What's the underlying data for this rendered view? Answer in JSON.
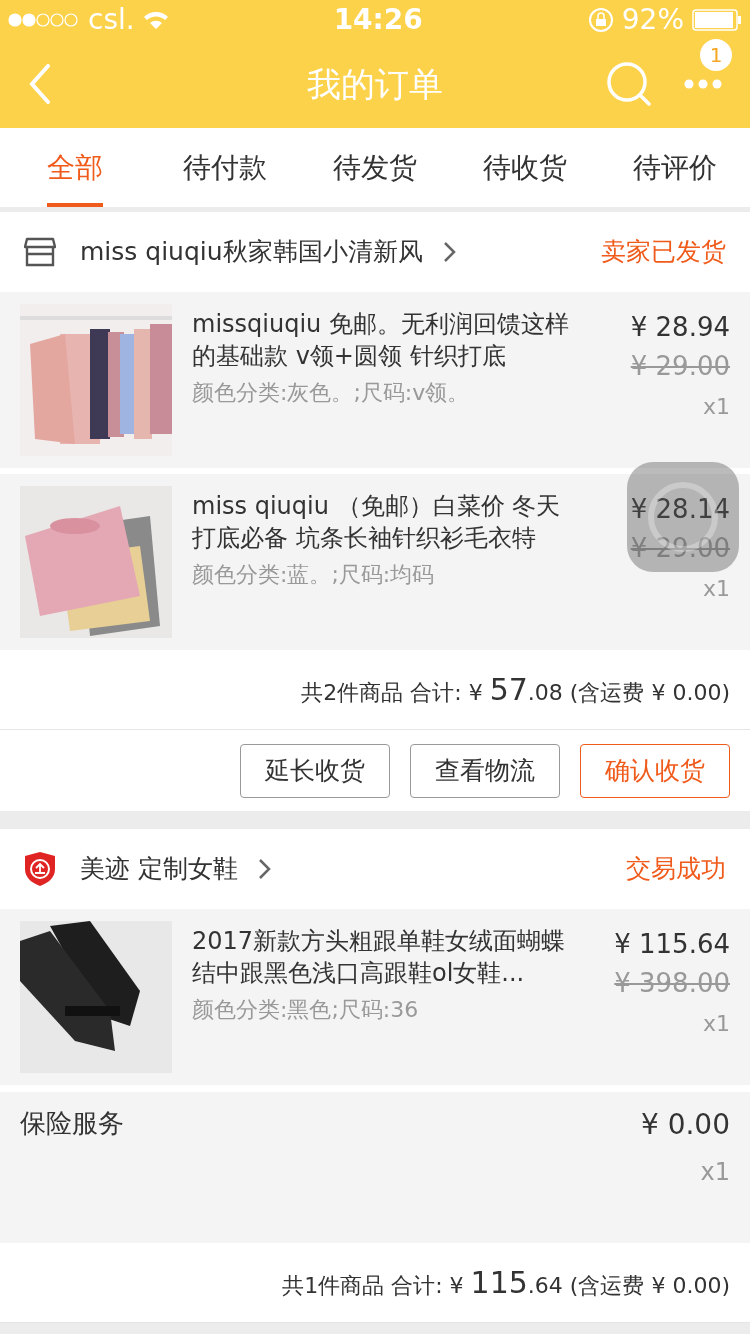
{
  "status_bar": {
    "carrier": "csl.",
    "time": "14:26",
    "battery": "92%"
  },
  "nav": {
    "title": "我的订单",
    "badge": "1"
  },
  "tabs": [
    {
      "label": "全部",
      "selected": true
    },
    {
      "label": "待付款",
      "selected": false
    },
    {
      "label": "待发货",
      "selected": false
    },
    {
      "label": "待收货",
      "selected": false
    },
    {
      "label": "待评价",
      "selected": false
    }
  ],
  "orders": [
    {
      "shop": {
        "kind": "store",
        "name": "miss qiuqiu秋家韩国小清新风"
      },
      "status": "卖家已发货",
      "items": [
        {
          "kind": "product",
          "title": "missqiuqiu 免邮。无利润回馈这样的基础款 v领+圆领 针织打底",
          "spec": "颜色分类:灰色。;尺码:v领。",
          "price": "¥ 28.94",
          "original_price": "¥ 29.00",
          "qty": "x1"
        },
        {
          "kind": "product",
          "title": "miss qiuqiu （免邮）白菜价 冬天打底必备 坑条长袖针织衫毛衣特",
          "spec": "颜色分类:蓝。;尺码:均码",
          "price": "¥ 28.14",
          "original_price": "¥ 29.00",
          "qty": "x1"
        }
      ],
      "total": {
        "label": "共2件商品 合计:",
        "currency": "¥",
        "integer": "57",
        "decimal": ".08",
        "shipping": "(含运费 ¥ 0.00)"
      },
      "buttons": [
        {
          "label": "延长收货",
          "highlighted": false
        },
        {
          "label": "查看物流",
          "highlighted": false
        },
        {
          "label": "确认收货",
          "highlighted": true
        }
      ]
    },
    {
      "shop": {
        "kind": "enterprise",
        "name": "美迹 定制女鞋"
      },
      "status": "交易成功",
      "items": [
        {
          "kind": "product",
          "title": "2017新款方头粗跟单鞋女绒面蝴蝶结中跟黑色浅口高跟鞋ol女鞋...",
          "spec": "颜色分类:黑色;尺码:36",
          "price": "¥ 115.64",
          "original_price": "¥ 398.00",
          "qty": "x1"
        },
        {
          "kind": "service",
          "title": "保险服务",
          "price": "¥ 0.00",
          "qty": "x1"
        }
      ],
      "total": {
        "label": "共1件商品 合计:",
        "currency": "¥",
        "integer": "115",
        "decimal": ".64",
        "shipping": "(含运费 ¥ 0.00)"
      }
    }
  ]
}
